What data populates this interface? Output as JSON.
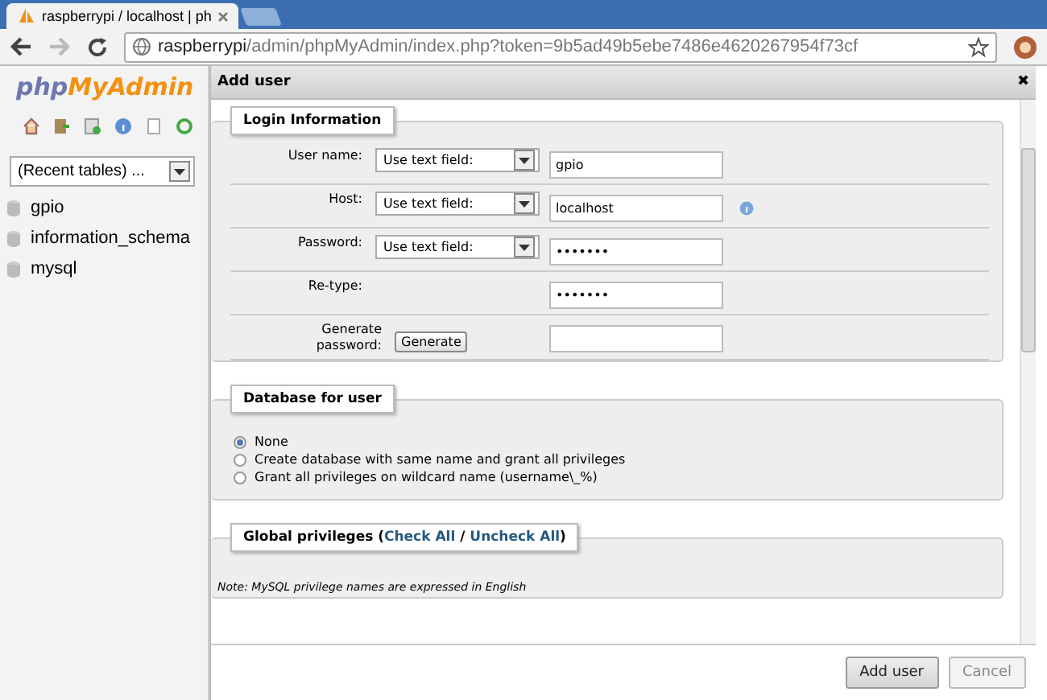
{
  "browser": {
    "tab_title": "raspberrypi / localhost | ph",
    "url_host": "raspberrypi",
    "url_path": "/admin/phpMyAdmin/index.php?token=9b5ad49b5ebe7486e4620267954f73cf"
  },
  "sidebar": {
    "logo_a": "php",
    "logo_b": "MyAdmin",
    "recent_tables": "(Recent tables) ...",
    "databases": [
      {
        "name": "gpio"
      },
      {
        "name": "information_schema"
      },
      {
        "name": "mysql"
      }
    ]
  },
  "dialog": {
    "title": "Add user",
    "close": "✖",
    "login": {
      "legend": "Login Information",
      "rows": [
        {
          "label": "User name:",
          "kind": "select",
          "select": "Use text field:",
          "value": "gpio",
          "help": false
        },
        {
          "label": "Host:",
          "kind": "select",
          "select": "Use text field:",
          "value": "localhost",
          "help": true
        },
        {
          "label": "Password:",
          "kind": "select",
          "select": "Use text field:",
          "value": "•••••••",
          "help": false
        },
        {
          "label": "Re-type:",
          "kind": "plain",
          "value": "•••••••",
          "help": false
        },
        {
          "label": "Generate password:",
          "kind": "generate",
          "button": "Generate",
          "value": "",
          "help": false
        }
      ]
    },
    "database": {
      "legend": "Database for user",
      "options": [
        {
          "label": "None",
          "selected": true
        },
        {
          "label": "Create database with same name and grant all privileges",
          "selected": false
        },
        {
          "label": "Grant all privileges on wildcard name (username\\_%)",
          "selected": false
        }
      ]
    },
    "global": {
      "legend_prefix": "Global privileges (",
      "check_all": "Check All",
      "separator": "/",
      "uncheck_all": "Uncheck All",
      "legend_suffix": ")",
      "note": "Note: MySQL privilege names are expressed in English"
    },
    "buttons": [
      {
        "label": "Add user",
        "kind": "primary"
      },
      {
        "label": "Cancel",
        "kind": "secondary"
      }
    ]
  }
}
